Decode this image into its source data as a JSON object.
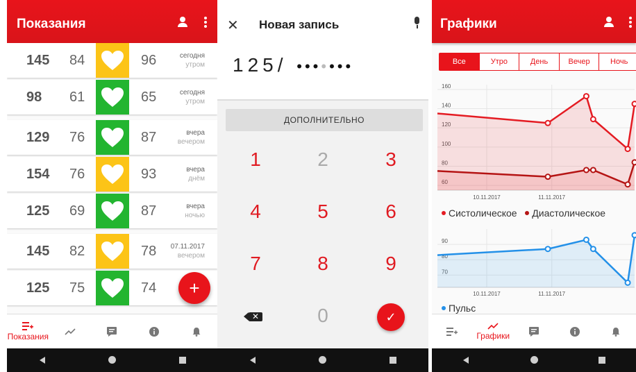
{
  "screens": {
    "readings": {
      "title": "Показания",
      "rows": [
        {
          "sys": "145",
          "dia": "84",
          "pulse": "96",
          "day": "сегодня",
          "time": "утром",
          "status": "#fcc417"
        },
        {
          "sys": "98",
          "dia": "61",
          "pulse": "65",
          "day": "сегодня",
          "time": "утром",
          "status": "#23b530"
        },
        {
          "sys": "129",
          "dia": "76",
          "pulse": "87",
          "day": "вчера",
          "time": "вечером",
          "status": "#23b530"
        },
        {
          "sys": "154",
          "dia": "76",
          "pulse": "93",
          "day": "вчера",
          "time": "днём",
          "status": "#fcc417"
        },
        {
          "sys": "125",
          "dia": "69",
          "pulse": "87",
          "day": "вчера",
          "time": "ночью",
          "status": "#23b530"
        },
        {
          "sys": "145",
          "dia": "82",
          "pulse": "78",
          "day": "07.11.2017",
          "time": "вечером",
          "status": "#fcc417"
        },
        {
          "sys": "125",
          "dia": "75",
          "pulse": "74",
          "day": "07",
          "time": "",
          "status": "#23b530"
        }
      ],
      "fab": "+",
      "nav": {
        "readings_label": "Показания"
      }
    },
    "entry": {
      "title": "Новая запись",
      "close": "✕",
      "input": "125",
      "slash": "/",
      "more": "ДОПОЛНИТЕЛЬНО",
      "keys": [
        "1",
        "2",
        "3",
        "4",
        "5",
        "6",
        "7",
        "8",
        "9",
        "0"
      ],
      "backspace": "✕",
      "ok": "✓"
    },
    "charts": {
      "title": "Графики",
      "segments": [
        "Все",
        "Утро",
        "День",
        "Вечер",
        "Ночь"
      ],
      "legend_sys": "Систолическое",
      "legend_dia": "Диастолическое",
      "legend_pulse": "Пульс",
      "nav_label": "Графики"
    }
  },
  "colors": {
    "accent": "#e8141b",
    "sys": "#e41b22",
    "dia": "#b51414",
    "pulse": "#2390e8",
    "green": "#23b530",
    "yellow": "#fcc417"
  },
  "chart_data": [
    {
      "type": "line",
      "y_ticks": [
        60,
        80,
        100,
        120,
        140,
        160
      ],
      "ylim": [
        55,
        165
      ],
      "x_tick_labels": [
        "10.11.2017",
        "11.11.2017"
      ],
      "series": [
        {
          "name": "Систолическое",
          "values": [
            135,
            125,
            153,
            129,
            98,
            145
          ]
        },
        {
          "name": "Диастолическое",
          "values": [
            75,
            69,
            76,
            76,
            61,
            84
          ]
        }
      ]
    },
    {
      "type": "line",
      "y_ticks": [
        70,
        80,
        90
      ],
      "ylim": [
        62,
        100
      ],
      "x_tick_labels": [
        "10.11.2017",
        "11.11.2017"
      ],
      "series": [
        {
          "name": "Пульс",
          "values": [
            83,
            87,
            93,
            87,
            65,
            96
          ]
        }
      ]
    }
  ]
}
